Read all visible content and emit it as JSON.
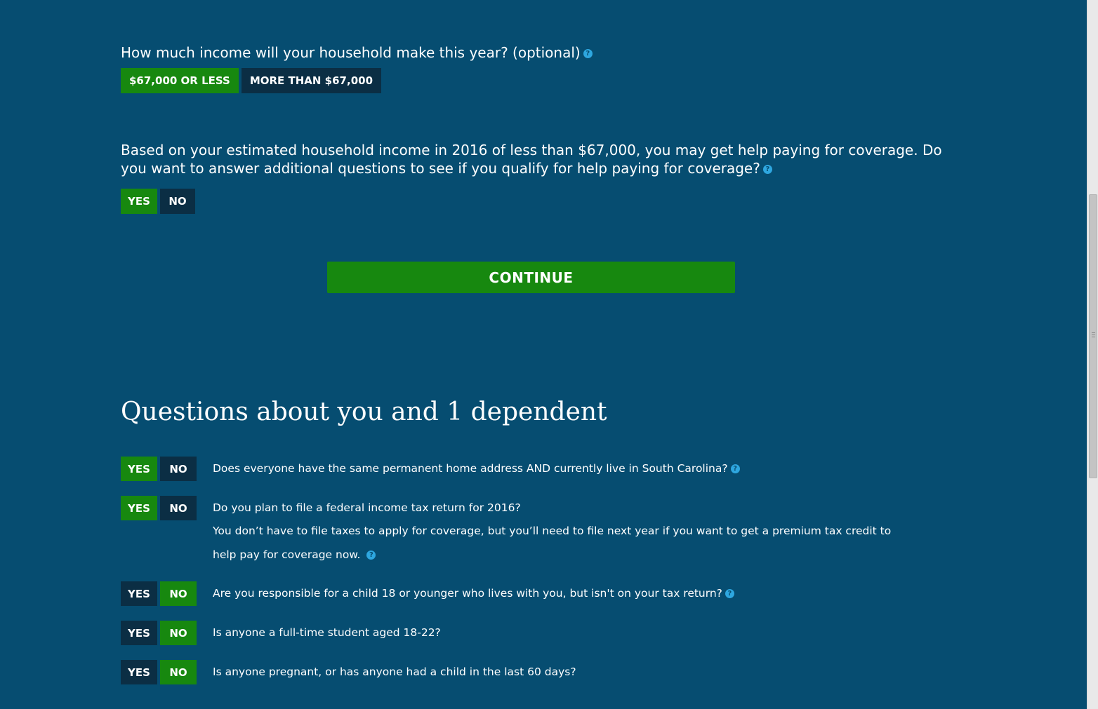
{
  "income_question": {
    "text": "How much income will your household make this year? (optional)",
    "options": [
      "$67,000 OR LESS",
      "MORE THAN $67,000"
    ],
    "selected": "$67,000 OR LESS"
  },
  "help_question": {
    "text": "Based on your estimated household income in 2016 of less than $67,000, you may get help paying for coverage. Do you want to answer additional questions to see if you qualify for help paying for coverage?",
    "yes_label": "YES",
    "no_label": "NO",
    "selected": "YES"
  },
  "continue_label": "CONTINUE",
  "section_title": "Questions about you and 1 dependent",
  "help_icon_glyph": "?",
  "questions": [
    {
      "text": "Does everyone have the same permanent home address AND currently live in South Carolina?",
      "sub": "",
      "yes_label": "YES",
      "no_label": "NO",
      "selected": "YES"
    },
    {
      "text": "Do you plan to file a federal income tax return for 2016?",
      "sub": "You don’t have to file taxes to apply for coverage, but you’ll need to file next year if you want to get a premium tax credit to help pay for coverage now.",
      "yes_label": "YES",
      "no_label": "NO",
      "selected": "YES"
    },
    {
      "text": "Are you responsible for a child 18 or younger who lives with you, but isn't on your tax return?",
      "sub": "",
      "yes_label": "YES",
      "no_label": "NO",
      "selected": "NO"
    },
    {
      "text": "Is anyone a full-time student aged 18-22?",
      "sub": "",
      "yes_label": "YES",
      "no_label": "NO",
      "selected": "NO"
    },
    {
      "text": "Is anyone pregnant, or has anyone had a child in the last 60 days?",
      "sub": "",
      "yes_label": "YES",
      "no_label": "NO",
      "selected": "NO"
    }
  ],
  "colors": {
    "background": "#064d71",
    "selected": "#17880f",
    "unselected": "#0b2e44",
    "help_icon": "#2ea7e0"
  }
}
